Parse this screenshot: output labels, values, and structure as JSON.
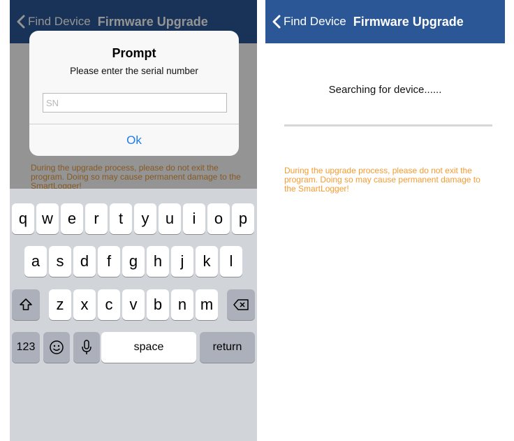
{
  "colors": {
    "nav_bar": "#2b5796",
    "warning_text": "#e89a3c",
    "ok_button": "#1a7cf0",
    "keyboard_bg": "#d1d4d9",
    "key_bg": "#ffffff",
    "system_key_bg": "#abb0ba"
  },
  "left_screen": {
    "nav": {
      "back_icon": "chevron-left-icon",
      "back_label": "Find Device",
      "title": "Firmware Upgrade"
    },
    "warning": "During the upgrade process, please do not exit the program. Doing so may cause permanent damage to the SmartLogger!",
    "alert": {
      "title": "Prompt",
      "message": "Please enter the serial number",
      "input_value": "",
      "input_placeholder": "SN",
      "ok_label": "Ok"
    },
    "keyboard": {
      "row1": [
        "q",
        "w",
        "e",
        "r",
        "t",
        "y",
        "u",
        "i",
        "o",
        "p"
      ],
      "row2": [
        "a",
        "s",
        "d",
        "f",
        "g",
        "h",
        "j",
        "k",
        "l"
      ],
      "row3": [
        "z",
        "x",
        "c",
        "v",
        "b",
        "n",
        "m"
      ],
      "shift_icon": "shift-arrow-icon",
      "delete_icon": "backspace-icon",
      "numbers_label": "123",
      "emoji_icon": "emoji-icon",
      "dictation_icon": "microphone-icon",
      "space_label": "space",
      "return_label": "return"
    }
  },
  "right_screen": {
    "nav": {
      "back_icon": "chevron-left-icon",
      "back_label": "Find Device",
      "title": "Firmware Upgrade"
    },
    "status": "Searching for device......",
    "progress_percent": 0,
    "warning": "During the upgrade process, please do not exit the program. Doing so may cause permanent damage to the SmartLogger!"
  }
}
